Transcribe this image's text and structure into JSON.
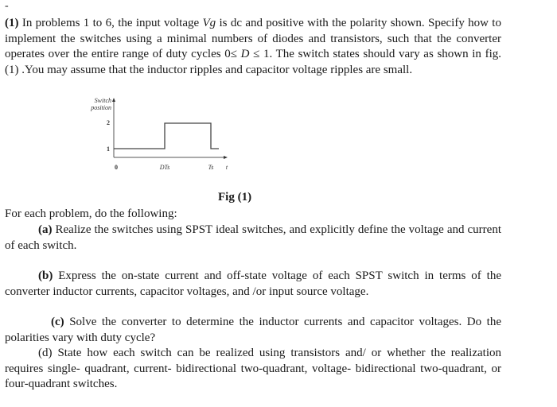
{
  "marker": "-",
  "problem": {
    "number": "(1)",
    "line1_a": " In problems 1 to 6, the input voltage ",
    "vg": "Vg",
    "line1_b": " is dc and positive with the polarity shown. Specify how to implement the switches using a minimal numbers of diodes and transistors, such that the converter operates over the entire range of duty cycles 0≤ ",
    "d": "D",
    "line1_c": " ≤ 1. The switch states should vary as shown in fig. (1) .You may assume that the inductor ripples and capacitor voltage ripples are small."
  },
  "figure": {
    "ylabel_line1": "Switch",
    "ylabel_line2": "position",
    "y_ticks": [
      "2",
      "1"
    ],
    "x_ticks": [
      "0",
      "DTs",
      "Ts"
    ],
    "x_axis_label": "t",
    "caption": "Fig (1)",
    "waveform": {
      "levels": [
        1,
        2,
        1
      ],
      "transitions": [
        "DTs",
        "Ts"
      ]
    }
  },
  "instructions": {
    "intro": "For each problem, do the following:",
    "a_label": "(a)",
    "a_text": " Realize the switches using SPST ideal switches, and explicitly define the voltage and current of each switch.",
    "b_label": "(b)",
    "b_text": " Express the on-state current and off-state voltage of each SPST switch in terms of the converter inductor currents, capacitor voltages, and /or input source voltage.",
    "c_label": "(c)",
    "c_text": " Solve the converter to determine the inductor currents and capacitor voltages. Do the polarities vary with duty cycle?",
    "d_label": "(d)",
    "d_text": "   State how each switch can be realized using transistors and/ or whether the realization requires single- quadrant, current- bidirectional two-quadrant, voltage- bidirectional two-quadrant, or four-quadrant switches."
  }
}
